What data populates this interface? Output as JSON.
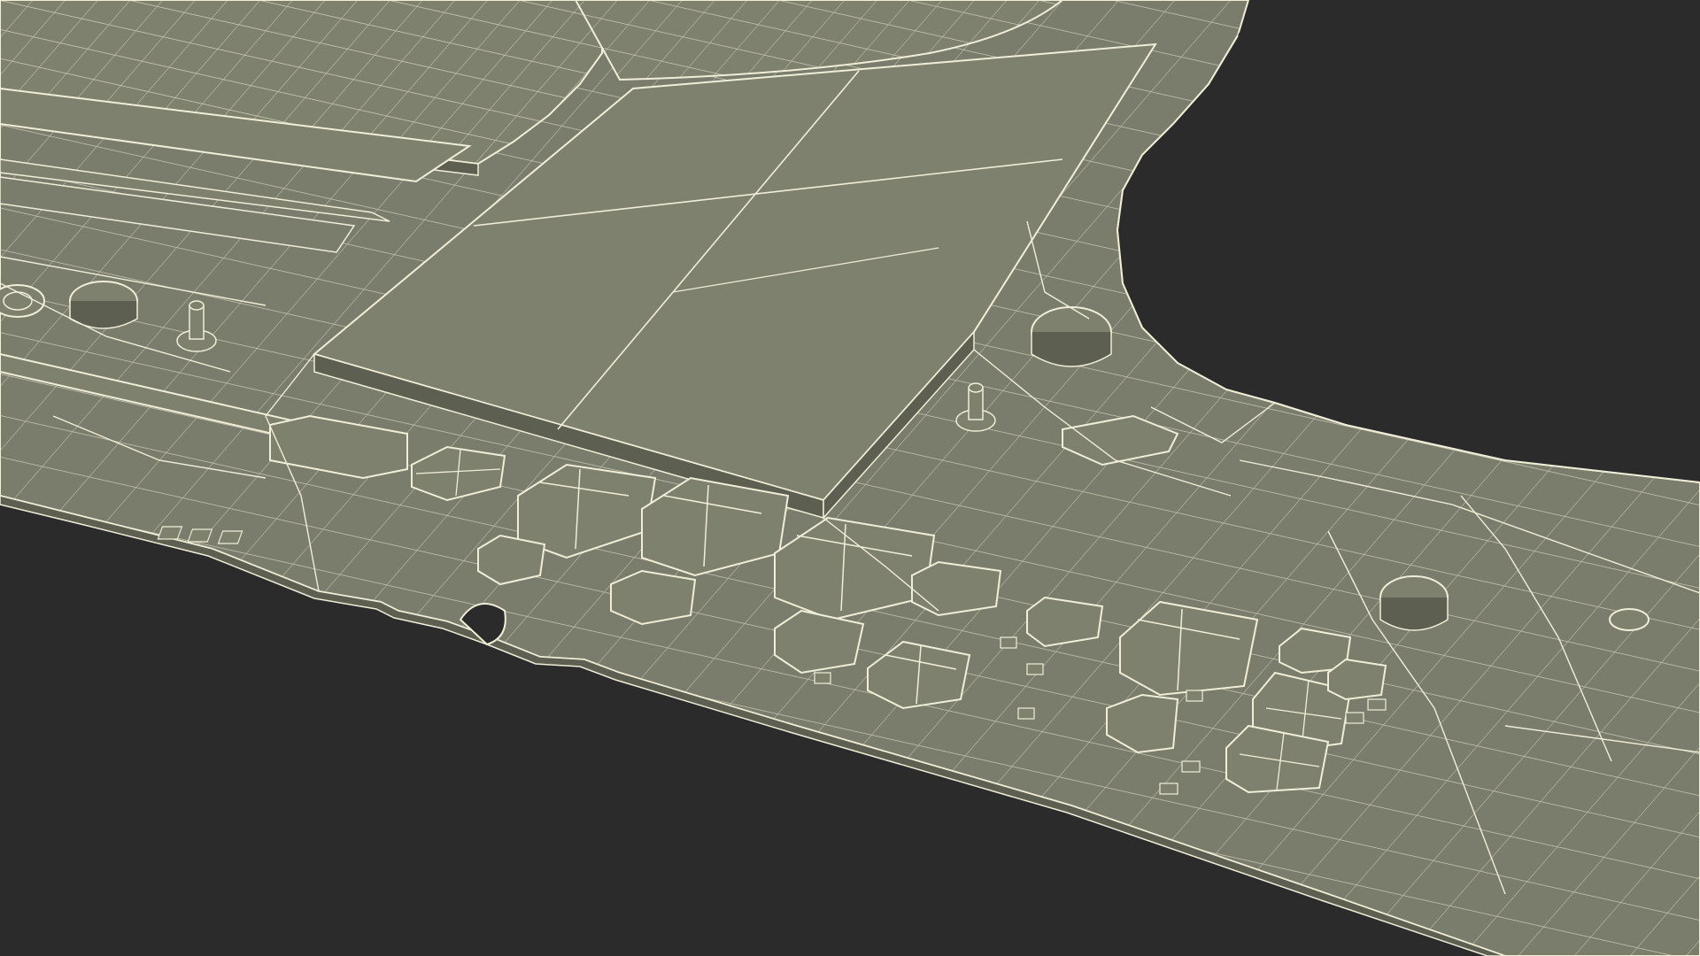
{
  "scene": {
    "background_color": "#2b2b2b",
    "board_color": "#7b7d6c",
    "board_shadow_color": "#676958",
    "component_color": "#7f816f",
    "component_side_color": "#5d5f50",
    "wire_color": "#efeed8"
  }
}
